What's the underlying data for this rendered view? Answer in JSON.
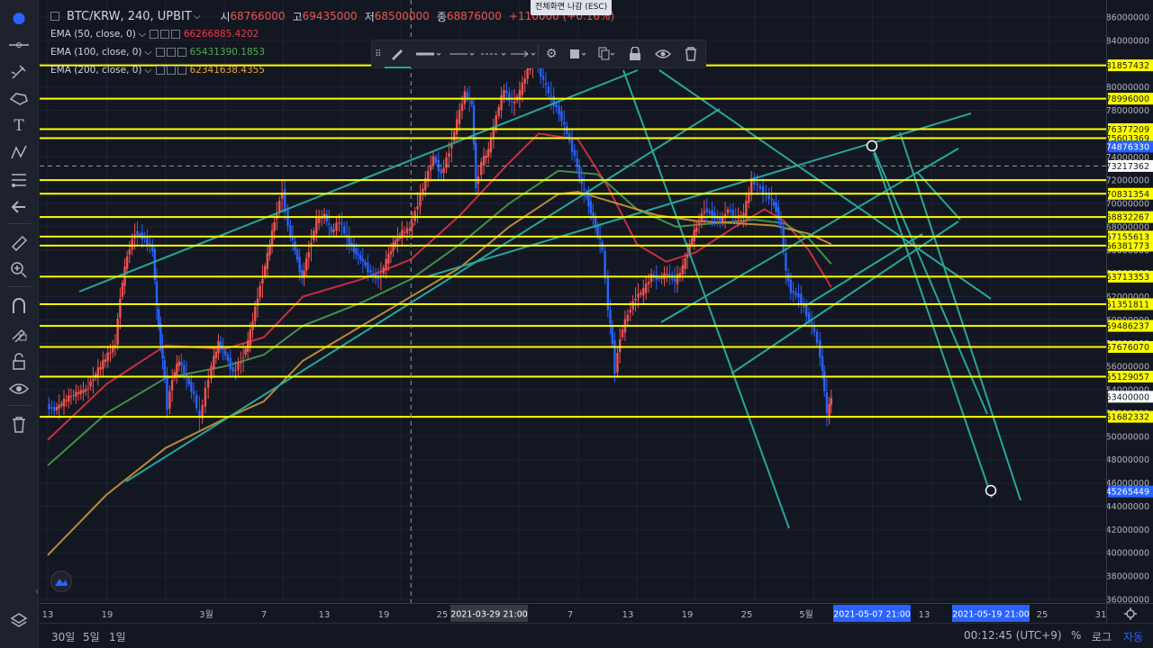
{
  "symbol": {
    "title": "BTC/KRW, 240, UPBIT",
    "ohlc": [
      {
        "label": "시",
        "value": "68766000"
      },
      {
        "label": "고",
        "value": "69435000"
      },
      {
        "label": "저",
        "value": "68500000"
      },
      {
        "label": "종",
        "value": "68876000"
      }
    ],
    "change": "+110000 (+0.16%)"
  },
  "esc_hint": "전체화면 나감 (ESC)",
  "indicators": [
    {
      "name": "EMA (50, close, 0)",
      "value": "66266885.4202",
      "color": "#f23645"
    },
    {
      "name": "EMA (100, close, 0)",
      "value": "65431390.1853",
      "color": "#4caf50"
    },
    {
      "name": "EMA (200, close, 0)",
      "value": "62341638.4355",
      "color": "#e3a83a"
    }
  ],
  "colors": {
    "background": "#131722",
    "hline": "#ffff00",
    "trendline": "#26a69a",
    "candle_up": "#ef5350",
    "candle_down": "#2962ff",
    "crosshair": "#9598a1"
  },
  "price_axis": {
    "ticks": [
      "86000000",
      "84000000",
      "82000000",
      "80000000",
      "78000000",
      "76000000",
      "74000000",
      "72000000",
      "70000000",
      "68000000",
      "66000000",
      "64000000",
      "62000000",
      "60000000",
      "58000000",
      "56000000",
      "54000000",
      "52000000",
      "50000000",
      "48000000",
      "46000000",
      "44000000",
      "42000000",
      "40000000",
      "38000000",
      "36000000"
    ],
    "hline_labels": [
      "81857432",
      "78996000",
      "76377209",
      "75603369",
      "70831354",
      "68832267",
      "67155613",
      "66381773",
      "63713353",
      "61351811",
      "59486237",
      "57676070",
      "55129057",
      "51682332"
    ],
    "markers": [
      {
        "label": "74876330",
        "kind": "blue"
      },
      {
        "label": "73217362",
        "kind": "dark"
      },
      {
        "label": "53400000",
        "kind": "dark"
      },
      {
        "label": "45265449",
        "kind": "blue"
      }
    ]
  },
  "time_axis": {
    "ticks": [
      "13",
      "19",
      "3월",
      "7",
      "13",
      "19",
      "25",
      "7",
      "13",
      "19",
      "25",
      "5월",
      "13",
      "25",
      "31"
    ],
    "highlights": [
      "2021-03-29   21:00",
      "2021-05-07   21:00",
      "2021-05-19   21:00"
    ]
  },
  "bottom_bar": {
    "ranges": [
      "30일",
      "5일",
      "1일"
    ],
    "clock": "00:12:45 (UTC+9)",
    "percent": "%",
    "log": "로그",
    "auto": "자동"
  },
  "chart_data": {
    "type": "line",
    "title": "BTC/KRW, 240, UPBIT",
    "xlabel": "",
    "ylabel": "",
    "ylim": [
      35400000,
      87100000
    ],
    "x_range": [
      "2021-02-13",
      "2021-05-31"
    ],
    "grid": true,
    "price_series_note": "",
    "series": [
      {
        "name": "BTC/KRW",
        "color": "#ef5350",
        "values": [
          [
            0.0,
            52600000
          ],
          [
            0.8,
            52300000
          ],
          [
            2.5,
            53500000
          ],
          [
            4.0,
            54000000
          ],
          [
            5.5,
            56000000
          ],
          [
            7.0,
            58000000
          ],
          [
            7.5,
            62000000
          ],
          [
            8.2,
            65500000
          ],
          [
            9.0,
            67500000
          ],
          [
            10.0,
            67000000
          ],
          [
            10.8,
            66000000
          ],
          [
            11.2,
            61000000
          ],
          [
            11.6,
            58000000
          ],
          [
            12.0,
            55000000
          ],
          [
            12.3,
            52500000
          ],
          [
            12.8,
            55000000
          ],
          [
            13.5,
            56500000
          ],
          [
            14.0,
            55500000
          ],
          [
            14.5,
            54500000
          ],
          [
            15.0,
            53500000
          ],
          [
            15.6,
            51500000
          ],
          [
            16.2,
            54000000
          ],
          [
            16.8,
            56000000
          ],
          [
            17.5,
            58000000
          ],
          [
            18.2,
            57000000
          ],
          [
            19.0,
            55500000
          ],
          [
            19.8,
            56500000
          ],
          [
            20.5,
            58000000
          ],
          [
            21.5,
            62000000
          ],
          [
            22.5,
            65500000
          ],
          [
            23.2,
            68500000
          ],
          [
            24.0,
            71000000
          ],
          [
            24.6,
            68000000
          ],
          [
            25.3,
            66000000
          ],
          [
            26.0,
            63500000
          ],
          [
            26.7,
            66000000
          ],
          [
            27.5,
            68500000
          ],
          [
            28.3,
            69000000
          ],
          [
            29.0,
            67500000
          ],
          [
            29.8,
            68500000
          ],
          [
            30.6,
            67000000
          ],
          [
            31.3,
            66000000
          ],
          [
            32.2,
            65000000
          ],
          [
            33.0,
            64000000
          ],
          [
            33.8,
            63500000
          ],
          [
            34.6,
            65000000
          ],
          [
            35.3,
            66500000
          ],
          [
            36.2,
            67500000
          ],
          [
            37.0,
            67800000
          ],
          [
            37.8,
            70000000
          ],
          [
            38.6,
            72000000
          ],
          [
            39.4,
            74000000
          ],
          [
            40.2,
            72500000
          ],
          [
            41.0,
            74500000
          ],
          [
            41.8,
            77000000
          ],
          [
            42.6,
            79500000
          ],
          [
            43.3,
            78500000
          ],
          [
            43.7,
            71500000
          ],
          [
            44.3,
            73500000
          ],
          [
            45.0,
            74500000
          ],
          [
            45.8,
            77500000
          ],
          [
            46.6,
            79800000
          ],
          [
            47.4,
            78500000
          ],
          [
            48.2,
            79500000
          ],
          [
            49.0,
            81500000
          ],
          [
            49.8,
            82200000
          ],
          [
            50.6,
            80500000
          ],
          [
            51.4,
            79000000
          ],
          [
            52.2,
            77800000
          ],
          [
            53.0,
            76000000
          ],
          [
            53.8,
            74000000
          ],
          [
            54.5,
            71500000
          ],
          [
            55.2,
            70000000
          ],
          [
            55.9,
            68000000
          ],
          [
            56.6,
            66000000
          ],
          [
            57.2,
            61000000
          ],
          [
            57.6,
            58000000
          ],
          [
            57.9,
            55600000
          ],
          [
            58.4,
            58500000
          ],
          [
            59.2,
            60500000
          ],
          [
            60.0,
            62000000
          ],
          [
            60.8,
            62500000
          ],
          [
            61.6,
            63800000
          ],
          [
            62.4,
            63500000
          ],
          [
            63.2,
            64000000
          ],
          [
            64.0,
            63300000
          ],
          [
            64.8,
            64500000
          ],
          [
            65.5,
            66500000
          ],
          [
            66.2,
            68000000
          ],
          [
            67.0,
            69500000
          ],
          [
            67.8,
            69000000
          ],
          [
            68.6,
            68500000
          ],
          [
            69.4,
            69500000
          ],
          [
            70.2,
            68800000
          ],
          [
            71.0,
            69000000
          ],
          [
            71.8,
            72000000
          ],
          [
            72.4,
            71500000
          ],
          [
            73.0,
            71000000
          ],
          [
            73.6,
            70500000
          ],
          [
            74.3,
            69500000
          ],
          [
            74.8,
            68000000
          ],
          [
            75.3,
            64000000
          ],
          [
            75.8,
            62500000
          ],
          [
            76.6,
            62000000
          ],
          [
            77.4,
            60500000
          ],
          [
            78.2,
            59000000
          ],
          [
            78.8,
            57000000
          ],
          [
            79.2,
            54000000
          ],
          [
            79.5,
            51800000
          ],
          [
            79.9,
            53400000
          ]
        ]
      },
      {
        "name": "EMA 50",
        "color": "#f23645",
        "values": [
          [
            0.0,
            49700000
          ],
          [
            6.0,
            54500000
          ],
          [
            12.0,
            57800000
          ],
          [
            18.0,
            57500000
          ],
          [
            22.0,
            58500000
          ],
          [
            26.0,
            62000000
          ],
          [
            32.0,
            63500000
          ],
          [
            37.0,
            65200000
          ],
          [
            42.0,
            69000000
          ],
          [
            47.0,
            73500000
          ],
          [
            50.0,
            76000000
          ],
          [
            54.0,
            75500000
          ],
          [
            57.0,
            71500000
          ],
          [
            60.0,
            66500000
          ],
          [
            63.0,
            65000000
          ],
          [
            66.0,
            65800000
          ],
          [
            70.0,
            68000000
          ],
          [
            73.0,
            69500000
          ],
          [
            75.0,
            68500000
          ],
          [
            77.5,
            66000000
          ],
          [
            79.8,
            62800000
          ]
        ]
      },
      {
        "name": "EMA 100",
        "color": "#4caf50",
        "values": [
          [
            0.0,
            47500000
          ],
          [
            6.0,
            52000000
          ],
          [
            12.0,
            55000000
          ],
          [
            18.0,
            56000000
          ],
          [
            22.0,
            57000000
          ],
          [
            26.0,
            59500000
          ],
          [
            32.0,
            61500000
          ],
          [
            37.0,
            63500000
          ],
          [
            42.0,
            66500000
          ],
          [
            47.0,
            70000000
          ],
          [
            52.0,
            72800000
          ],
          [
            56.0,
            72500000
          ],
          [
            60.0,
            69500000
          ],
          [
            64.0,
            68000000
          ],
          [
            68.0,
            68300000
          ],
          [
            72.0,
            68600000
          ],
          [
            75.0,
            68300000
          ],
          [
            77.5,
            67000000
          ],
          [
            79.8,
            64800000
          ]
        ]
      },
      {
        "name": "EMA 200",
        "color": "#e3a83a",
        "values": [
          [
            0.0,
            39800000
          ],
          [
            6.0,
            45000000
          ],
          [
            12.0,
            49000000
          ],
          [
            18.0,
            51500000
          ],
          [
            22.0,
            53000000
          ],
          [
            26.0,
            56500000
          ],
          [
            32.0,
            59500000
          ],
          [
            37.0,
            62000000
          ],
          [
            42.0,
            64500000
          ],
          [
            47.0,
            68000000
          ],
          [
            52.0,
            70800000
          ],
          [
            54.0,
            71000000
          ],
          [
            58.0,
            70000000
          ],
          [
            62.0,
            69000000
          ],
          [
            66.0,
            68500000
          ],
          [
            70.0,
            68300000
          ],
          [
            74.0,
            68100000
          ],
          [
            77.5,
            67400000
          ],
          [
            79.8,
            66500000
          ]
        ]
      }
    ],
    "horizontal_levels": [
      81857432,
      78996000,
      76377209,
      75603369,
      72000000,
      70831354,
      68832267,
      67155613,
      66381773,
      63713353,
      61351811,
      59486237,
      57676070,
      55129057,
      51682332
    ],
    "crosshair": {
      "x": 37.0,
      "y": 73217362
    }
  }
}
